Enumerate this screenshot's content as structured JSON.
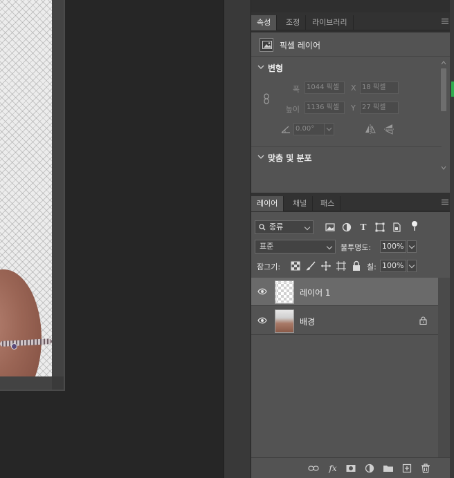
{
  "properties_panel": {
    "tabs": [
      {
        "label": "속성",
        "active": true
      },
      {
        "label": "조정",
        "active": false
      },
      {
        "label": "라이브러리",
        "active": false
      }
    ],
    "layer_type_label": "픽셀 레이어",
    "transform": {
      "title": "변형",
      "width_label": "폭",
      "width_value": "1044 픽셀",
      "height_label": "높이",
      "height_value": "1136 픽셀",
      "x_label": "X",
      "x_value": "18 픽셀",
      "y_label": "Y",
      "y_value": "27 픽셀",
      "angle_value": "0.00°"
    },
    "align_section": {
      "title": "맞춤 및 분포"
    }
  },
  "layers_panel": {
    "tabs": [
      {
        "label": "레이어",
        "active": true
      },
      {
        "label": "채널",
        "active": false
      },
      {
        "label": "패스",
        "active": false
      }
    ],
    "filter_kind": "종류",
    "blend_mode": "표준",
    "opacity_label": "불투명도:",
    "opacity_value": "100%",
    "lock_label": "잠그기:",
    "fill_label": "칠:",
    "fill_value": "100%",
    "layers": [
      {
        "name": "레이어 1",
        "selected": true,
        "visible": true,
        "locked": false
      },
      {
        "name": "배경",
        "selected": false,
        "visible": true,
        "locked": true
      }
    ],
    "footer_fx_label": "fx"
  },
  "colors": {
    "panel_bg": "#535353",
    "tab_active": "#535353",
    "selected_row": "#6a6a6a",
    "canvas_bg": "#262626"
  }
}
